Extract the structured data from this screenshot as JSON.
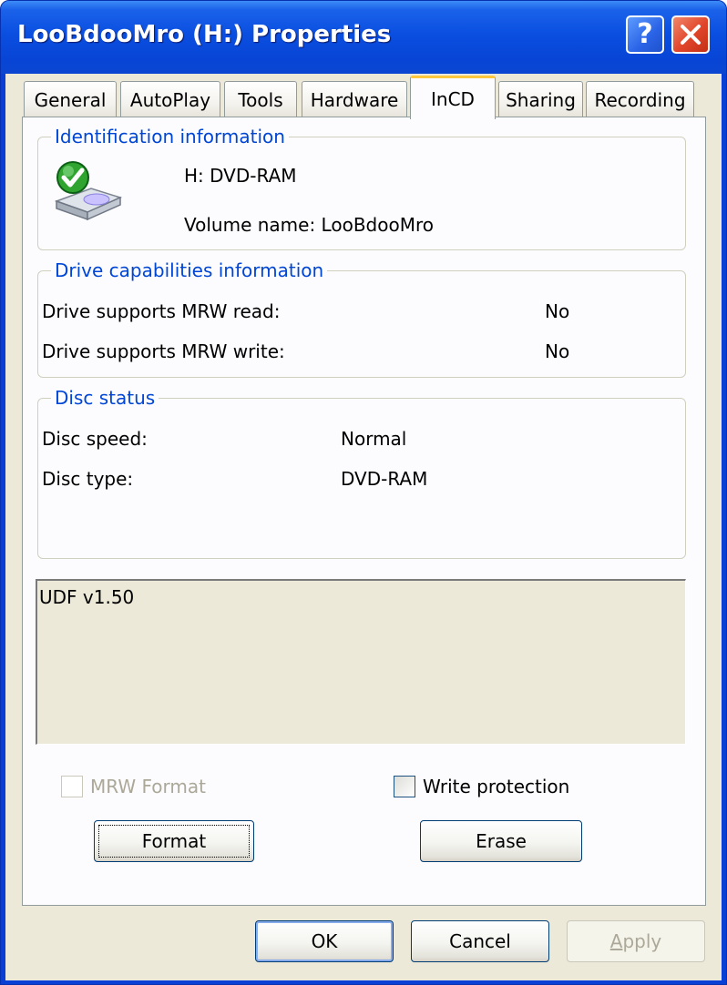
{
  "window": {
    "title": "LooBdooMro (H:) Properties"
  },
  "tabs": [
    {
      "label": "General"
    },
    {
      "label": "AutoPlay"
    },
    {
      "label": "Tools"
    },
    {
      "label": "Hardware"
    },
    {
      "label": "InCD",
      "active": true
    },
    {
      "label": "Sharing"
    },
    {
      "label": "Recording"
    }
  ],
  "identification": {
    "title": "Identification information",
    "drive": "H:  DVD-RAM",
    "volume": "Volume name: LooBdooMro",
    "icon": "drive-check-icon"
  },
  "capabilities": {
    "title": "Drive capabilities information",
    "rows": [
      {
        "label": "Drive supports MRW read:",
        "value": "No"
      },
      {
        "label": "Drive supports MRW write:",
        "value": "No"
      }
    ]
  },
  "disc_status": {
    "title": "Disc status",
    "rows": [
      {
        "label": "Disc speed:",
        "value": "Normal"
      },
      {
        "label": "Disc type:",
        "value": "DVD-RAM"
      }
    ]
  },
  "info_text": "UDF v1.50",
  "options": {
    "mrw_format": {
      "label": "MRW Format",
      "checked": false,
      "enabled": false
    },
    "write_protection": {
      "label": "Write protection",
      "checked": false,
      "enabled": true
    }
  },
  "actions": {
    "format": "Format",
    "erase": "Erase"
  },
  "footer": {
    "ok": "OK",
    "cancel": "Cancel",
    "apply": "Apply"
  },
  "colors": {
    "titlebar": "#0a4fe0",
    "group_title": "#0046d5",
    "dialog_bg": "#ece9d8",
    "active_tab_accent": "#ffc83c",
    "close": "#e0452a"
  }
}
